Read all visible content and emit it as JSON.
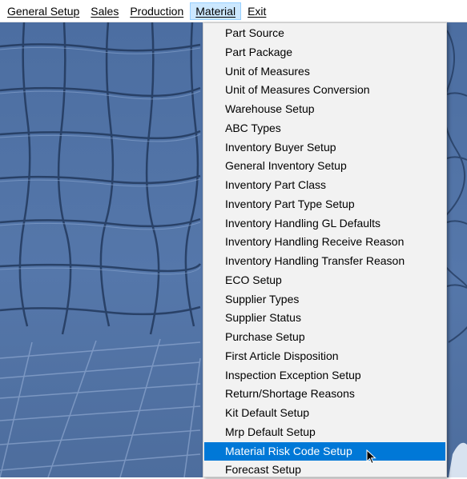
{
  "menubar": {
    "items": [
      "General Setup",
      "Sales",
      "Production",
      "Material",
      "Exit"
    ],
    "active": "Material"
  },
  "material_menu": {
    "items": [
      "Part Source",
      "Part Package",
      "Unit of Measures",
      "Unit of Measures Conversion",
      "Warehouse Setup",
      "ABC Types",
      "Inventory Buyer Setup",
      "General Inventory Setup",
      "Inventory Part Class",
      "Inventory Part Type Setup",
      "Inventory Handling GL Defaults",
      "Inventory Handling Receive Reason",
      "Inventory Handling Transfer Reason",
      "ECO Setup",
      "Supplier Types",
      "Supplier Status",
      "Purchase Setup",
      "First Article Disposition",
      "Inspection Exception Setup",
      "Return/Shortage Reasons",
      "Kit Default Setup",
      "Mrp Default Setup",
      "Material Risk Code Setup",
      "Forecast Setup"
    ],
    "highlighted": "Material Risk Code Setup"
  },
  "colors": {
    "menu_highlight": "#0078d7",
    "menubar_active": "#cce8ff",
    "backdrop": "#5577aa"
  },
  "icons": {
    "cursor": "mouse-pointer-icon"
  }
}
